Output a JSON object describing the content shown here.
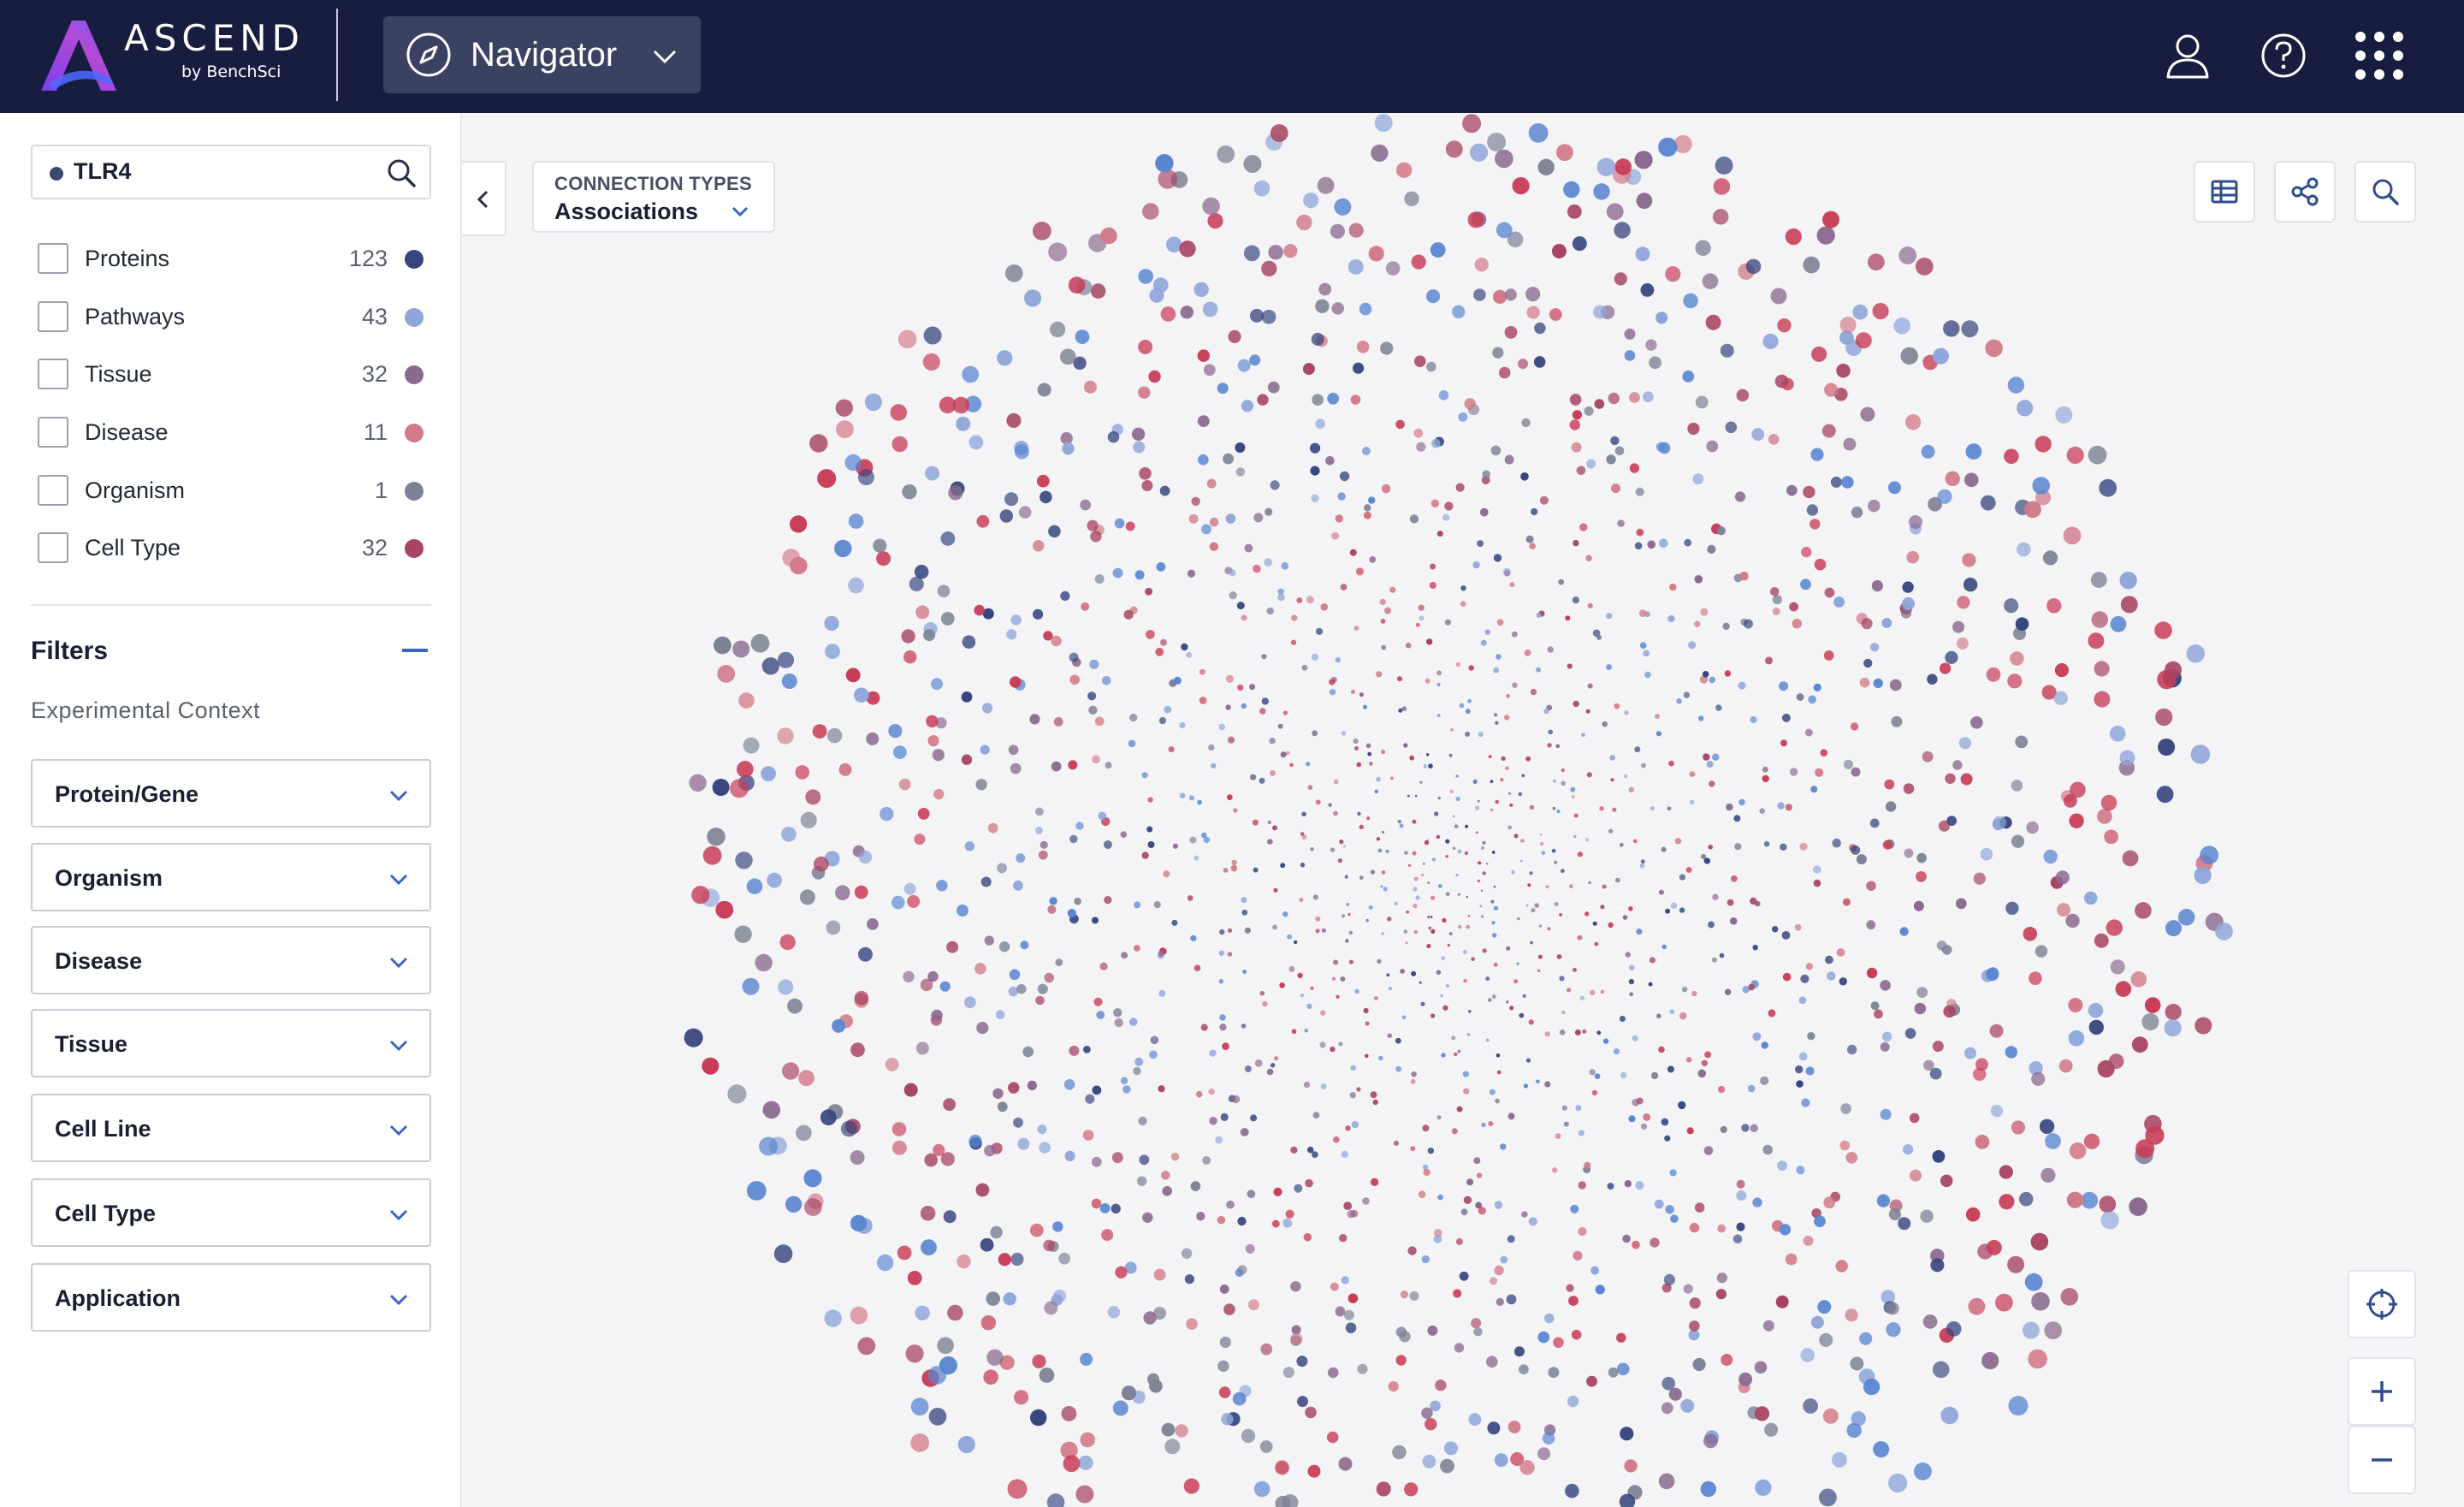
{
  "app": {
    "brand": "ASCEND",
    "brand_sub": "by BenchSci",
    "nav_label": "Navigator",
    "colors": {
      "topbar": "#161d3f",
      "accent": "#3a66c4"
    }
  },
  "top_icons": [
    "user-icon",
    "help-icon",
    "apps-grid-icon"
  ],
  "search": {
    "value": "TLR4"
  },
  "categories": [
    {
      "label": "Proteins",
      "count": "123",
      "color": "#36457e"
    },
    {
      "label": "Pathways",
      "count": "43",
      "color": "#8fa6d9"
    },
    {
      "label": "Tissue",
      "count": "32",
      "color": "#8a6a8e"
    },
    {
      "label": "Disease",
      "count": "11",
      "color": "#d27a88"
    },
    {
      "label": "Organism",
      "count": "1",
      "color": "#7d8294"
    },
    {
      "label": "Cell Type",
      "count": "32",
      "color": "#a84563"
    }
  ],
  "filters": {
    "title": "Filters",
    "context_title": "Experimental Context",
    "dropdowns": [
      "Protein/Gene",
      "Organism",
      "Disease",
      "Tissue",
      "Cell Line",
      "Cell Type",
      "Application"
    ]
  },
  "connection_types": {
    "title": "CONNECTION TYPES",
    "value": "Associations"
  },
  "graph": {
    "node_palette": [
      "#36457e",
      "#8fa6d9",
      "#8a6a8e",
      "#d27a88",
      "#7d8294",
      "#a84563",
      "#5a86d1",
      "#c83d58"
    ]
  }
}
